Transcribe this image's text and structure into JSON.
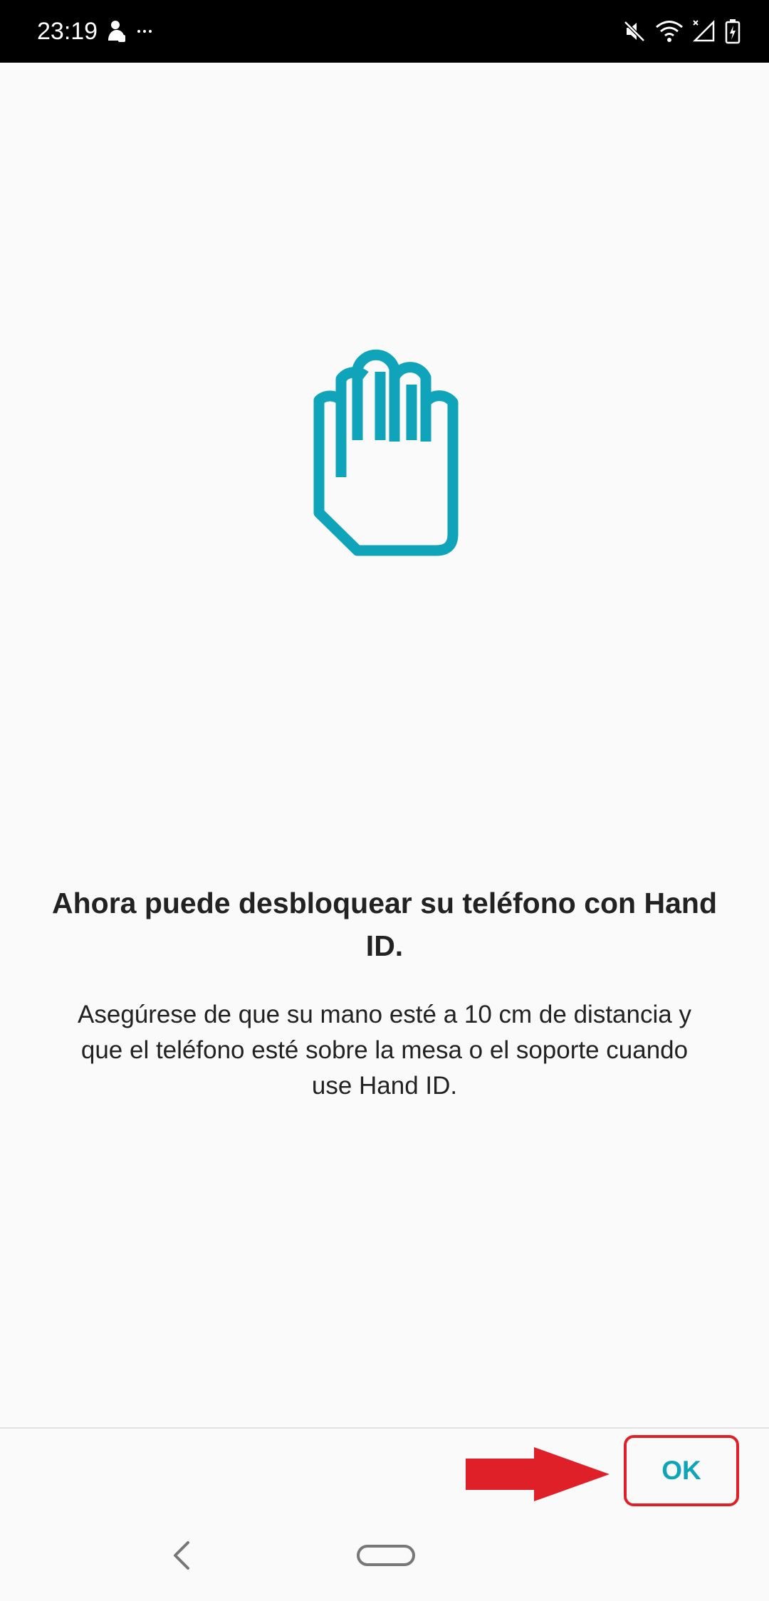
{
  "status_bar": {
    "time": "23:19",
    "left_icons": [
      "notification-person-icon",
      "more-dots-icon"
    ],
    "right_icons": [
      "mute-icon",
      "wifi-icon",
      "signal-icon",
      "battery-charging-icon"
    ]
  },
  "content": {
    "icon": "hand-icon",
    "title": "Ahora puede desbloquear su teléfono con Hand ID.",
    "description": "Asegúrese de que su mano esté a 10 cm de distancia y que el teléfono esté sobre la mesa o el soporte cuando use Hand ID."
  },
  "footer": {
    "ok_label": "OK"
  },
  "navigation": {
    "icons": [
      "back-icon",
      "home-icon"
    ]
  },
  "colors": {
    "accent": "#0fa4ba",
    "annotation_red": "#e02028",
    "background": "#fafafa",
    "status_bar": "#000000",
    "text": "#222222"
  }
}
